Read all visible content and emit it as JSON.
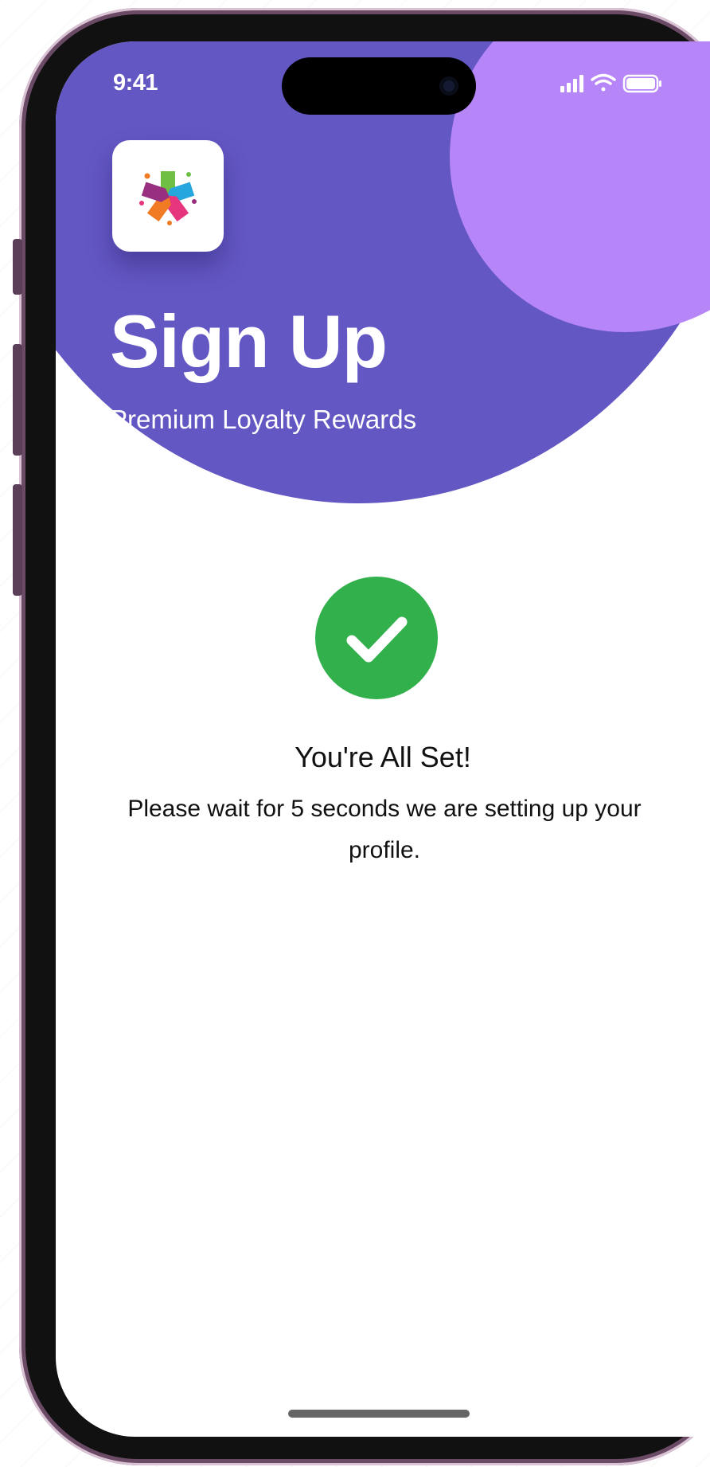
{
  "status_bar": {
    "time": "9:41",
    "icons": [
      "signal-icon",
      "wifi-icon",
      "battery-icon"
    ]
  },
  "header": {
    "title": "Sign Up",
    "subtitle": "Premium Loyalty Rewards",
    "logo_icon": "loyalty-tags-logo-icon"
  },
  "confirmation": {
    "icon": "check-icon",
    "title": "You're All Set!",
    "message": "Please wait for 5 seconds we are setting up your profile."
  },
  "colors": {
    "header_purple": "#6357c3",
    "accent_lavender": "#b685f8",
    "success_green": "#31b04c"
  }
}
